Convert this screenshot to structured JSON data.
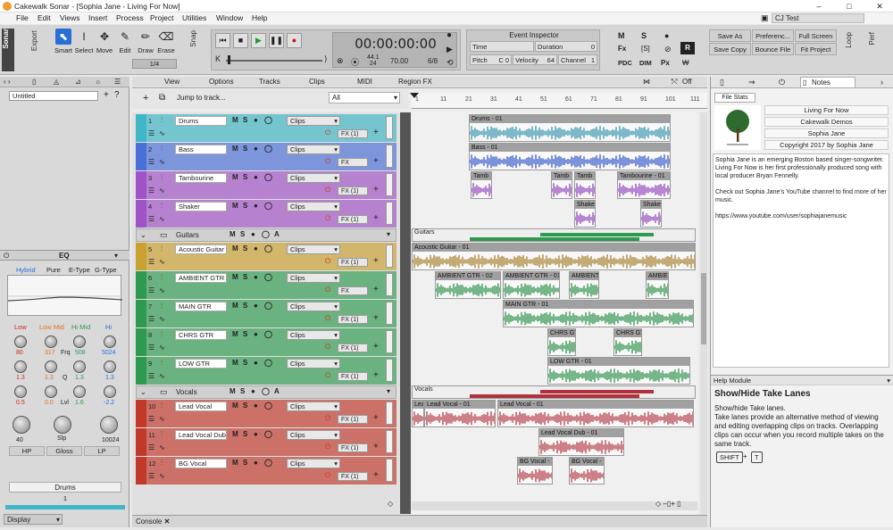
{
  "window": {
    "title": "Cakewalk Sonar - [Sophia Jane - Living For Now]",
    "min": "–",
    "max": "□",
    "close": "✕"
  },
  "menu": [
    "File",
    "Edit",
    "Views",
    "Insert",
    "Process",
    "Project",
    "Utilities",
    "Window",
    "Help"
  ],
  "profile": "CJ Test",
  "toolbar": {
    "brand": "Sonar",
    "export": "Export",
    "tools": [
      {
        "label": "Smart",
        "icon": "arrow-cursor-icon",
        "glyph": "⬉"
      },
      {
        "label": "Select",
        "icon": "text-cursor-icon",
        "glyph": "I"
      },
      {
        "label": "Move",
        "icon": "move-icon",
        "glyph": "✥"
      },
      {
        "label": "Edit",
        "icon": "wrench-icon",
        "glyph": "✎"
      },
      {
        "label": "Draw",
        "icon": "pencil-icon",
        "glyph": "✏"
      },
      {
        "label": "Erase",
        "icon": "eraser-icon",
        "glyph": "⌫"
      }
    ],
    "snap_fraction": "1/4",
    "snap": "Snap"
  },
  "transport": {
    "time": "00:00:00:00",
    "sample_rate": "44.1",
    "bit_depth": "24",
    "tempo": "70.00",
    "meter": "6/8",
    "buttons": [
      "rewind",
      "stop",
      "play",
      "pause",
      "record"
    ]
  },
  "event_inspector": {
    "title": "Event Inspector",
    "time_label": "Time",
    "time_value": "",
    "duration_label": "Duration",
    "duration_value": "0",
    "pitch_label": "Pitch",
    "pitch_value": "C 0",
    "velocity_label": "Velocity",
    "velocity_value": "64",
    "channel_label": "Channel",
    "channel_value": "1"
  },
  "mix": {
    "m": "M",
    "s": "S",
    "r": "R",
    "fx": "Fx",
    "pdc": "PDC",
    "dim": "DIM",
    "px": "Px"
  },
  "rightbuttons": [
    "Save As",
    "Preferenc...",
    "Full Screen",
    "Save Copy",
    "Bounce File",
    "Fit Project"
  ],
  "loop": "Loop",
  "perf": "Perf",
  "leftpanel": {
    "project": "Untitled",
    "eq_title": "EQ",
    "eq_modes": [
      "Hybrid",
      "Pure",
      "E-Type",
      "G-Type"
    ],
    "eq_bands": [
      "Low",
      "Low Mid",
      "Hi Mid",
      "Hi"
    ],
    "band_freqs": [
      "80",
      "317",
      "508",
      "5024"
    ],
    "band_q": [
      "1.3",
      "1.3",
      "1.3",
      "1.3"
    ],
    "band_gain": [
      "0.5",
      "0.0",
      "1.6",
      "-2.2"
    ],
    "frq": "Frq",
    "q": "Q",
    "lvl": "Lvl",
    "slp": "Slp",
    "hp_val": "40",
    "lp_val": "10024",
    "filters": [
      "HP",
      "Gloss",
      "LP"
    ],
    "strip_name": "Drums",
    "strip_num": "1",
    "display": "Display"
  },
  "trackview": {
    "menu": [
      "View",
      "Options",
      "Tracks",
      "Clips",
      "MIDI",
      "Region FX"
    ],
    "off": "Off",
    "jump": "Jump to track...",
    "filter": "All",
    "ruler": [
      "1",
      "11",
      "21",
      "31",
      "41",
      "51",
      "61",
      "71",
      "81",
      "91",
      "101",
      "111"
    ],
    "clips_label": "Clips",
    "msr": [
      "M",
      "S",
      "●",
      "◯"
    ],
    "fx_label": "FX (1)",
    "fx_plain": "FX",
    "tracks": [
      {
        "num": "1",
        "name": "Drums",
        "color": "#3fb7c6",
        "fx": "FX (1)"
      },
      {
        "num": "2",
        "name": "Bass",
        "color": "#4a6fd8",
        "fx": "FX"
      },
      {
        "num": "3",
        "name": "Tambourine",
        "color": "#a052c8",
        "fx": "FX (1)"
      },
      {
        "num": "4",
        "name": "Shaker",
        "color": "#a052c8",
        "fx": "FX (1)"
      },
      {
        "num": "5",
        "name": "Acoustic Guitar",
        "color": "#c9a032",
        "fx": "FX (1)"
      },
      {
        "num": "6",
        "name": "AMBIENT GTR",
        "color": "#2e9a4f",
        "fx": "FX"
      },
      {
        "num": "7",
        "name": "MAIN GTR",
        "color": "#2e9a4f",
        "fx": "FX (1)"
      },
      {
        "num": "8",
        "name": "CHRS GTR",
        "color": "#2e9a4f",
        "fx": "FX (1)"
      },
      {
        "num": "9",
        "name": "LOW GTR",
        "color": "#2e9a4f",
        "fx": "FX (1)"
      },
      {
        "num": "10",
        "name": "Lead Vocal",
        "color": "#c0392b",
        "fx": "FX (1)"
      },
      {
        "num": "11",
        "name": "Lead Vocal Dub",
        "color": "#c0392b",
        "fx": "FX (1)"
      },
      {
        "num": "12",
        "name": "BG Vocal",
        "color": "#c0392b",
        "fx": "FX (1)"
      }
    ],
    "folders": [
      {
        "name": "Guitars",
        "a": "A"
      },
      {
        "name": "Vocals",
        "a": "A"
      }
    ],
    "clips": {
      "drums": "Drums - 01",
      "bass": "Bass - 01",
      "tamb1": "Tamb",
      "tamb2": "Tamb",
      "tamb3": "Tamb",
      "tamb4": "Tambourine - 01",
      "shaker1": "Shaker",
      "shaker2": "Shaker",
      "guitars": "Guitars",
      "acoustic": "Acoustic Guitar - 01",
      "amb1": "AMBIENT GTR - 02",
      "amb2": "AMBIENT GTR - 01",
      "amb3": "AMBIENT",
      "amb4": "AMBIENT G",
      "main": "MAIN GTR - 01",
      "chrs1": "CHRS GT",
      "chrs2": "CHRS GT",
      "low": "LOW GTR - 01",
      "vocals": "Vocals",
      "lead0": "Lea",
      "lead1": "Lead Vocal - 01",
      "lead2": "Lead Vocal - 01",
      "dub": "Lead Vocal Dub - 01",
      "bg1": "BG Vocal -",
      "bg2": "BG Vocal -"
    }
  },
  "rightpanel": {
    "tabs": [
      "Notes"
    ],
    "file_stats": "File Stats",
    "info": [
      "Living For Now",
      "Cakewalk Demos",
      "Sophia Jane",
      "Copyright 2017 by Sophia Jane"
    ],
    "notes": "Sophia Jane is an emerging Boston based singer-songwriter. Living For Now is her first professionally produced song with local producer Bryan Fennelly.",
    "notes2": "Check out Sophia Jane's YouTube channel to find more of her music.",
    "url": "https://www.youtube.com/user/sophiajanemusic",
    "help_module": "Help Module",
    "help_title": "Show/Hide Take Lanes",
    "help_line1": "Show/hide Take lanes.",
    "help_body": "Take lanes provide an alternative method of viewing and editing overlapping clips on tracks. Overlapping clips can occur when you record multiple takes on the same track.",
    "key1": "SHIFT",
    "plus": "+",
    "key2": "T"
  },
  "console": "Console"
}
